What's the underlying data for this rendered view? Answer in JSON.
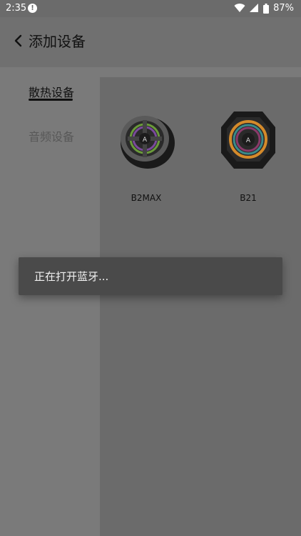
{
  "status_bar": {
    "time": "2:35",
    "battery": "87%"
  },
  "header": {
    "title": "添加设备"
  },
  "sidebar": {
    "items": [
      {
        "label": "散热设备",
        "active": true
      },
      {
        "label": "音频设备",
        "active": false
      }
    ]
  },
  "devices": [
    {
      "name": "B2MAX"
    },
    {
      "name": "B21"
    }
  ],
  "toast": {
    "message": "正在打开蓝牙..."
  },
  "colors": {
    "overlay_bg": "#7a7a7a",
    "content_bg": "#6b6b6b",
    "toast_bg": "#4a4a4a"
  }
}
